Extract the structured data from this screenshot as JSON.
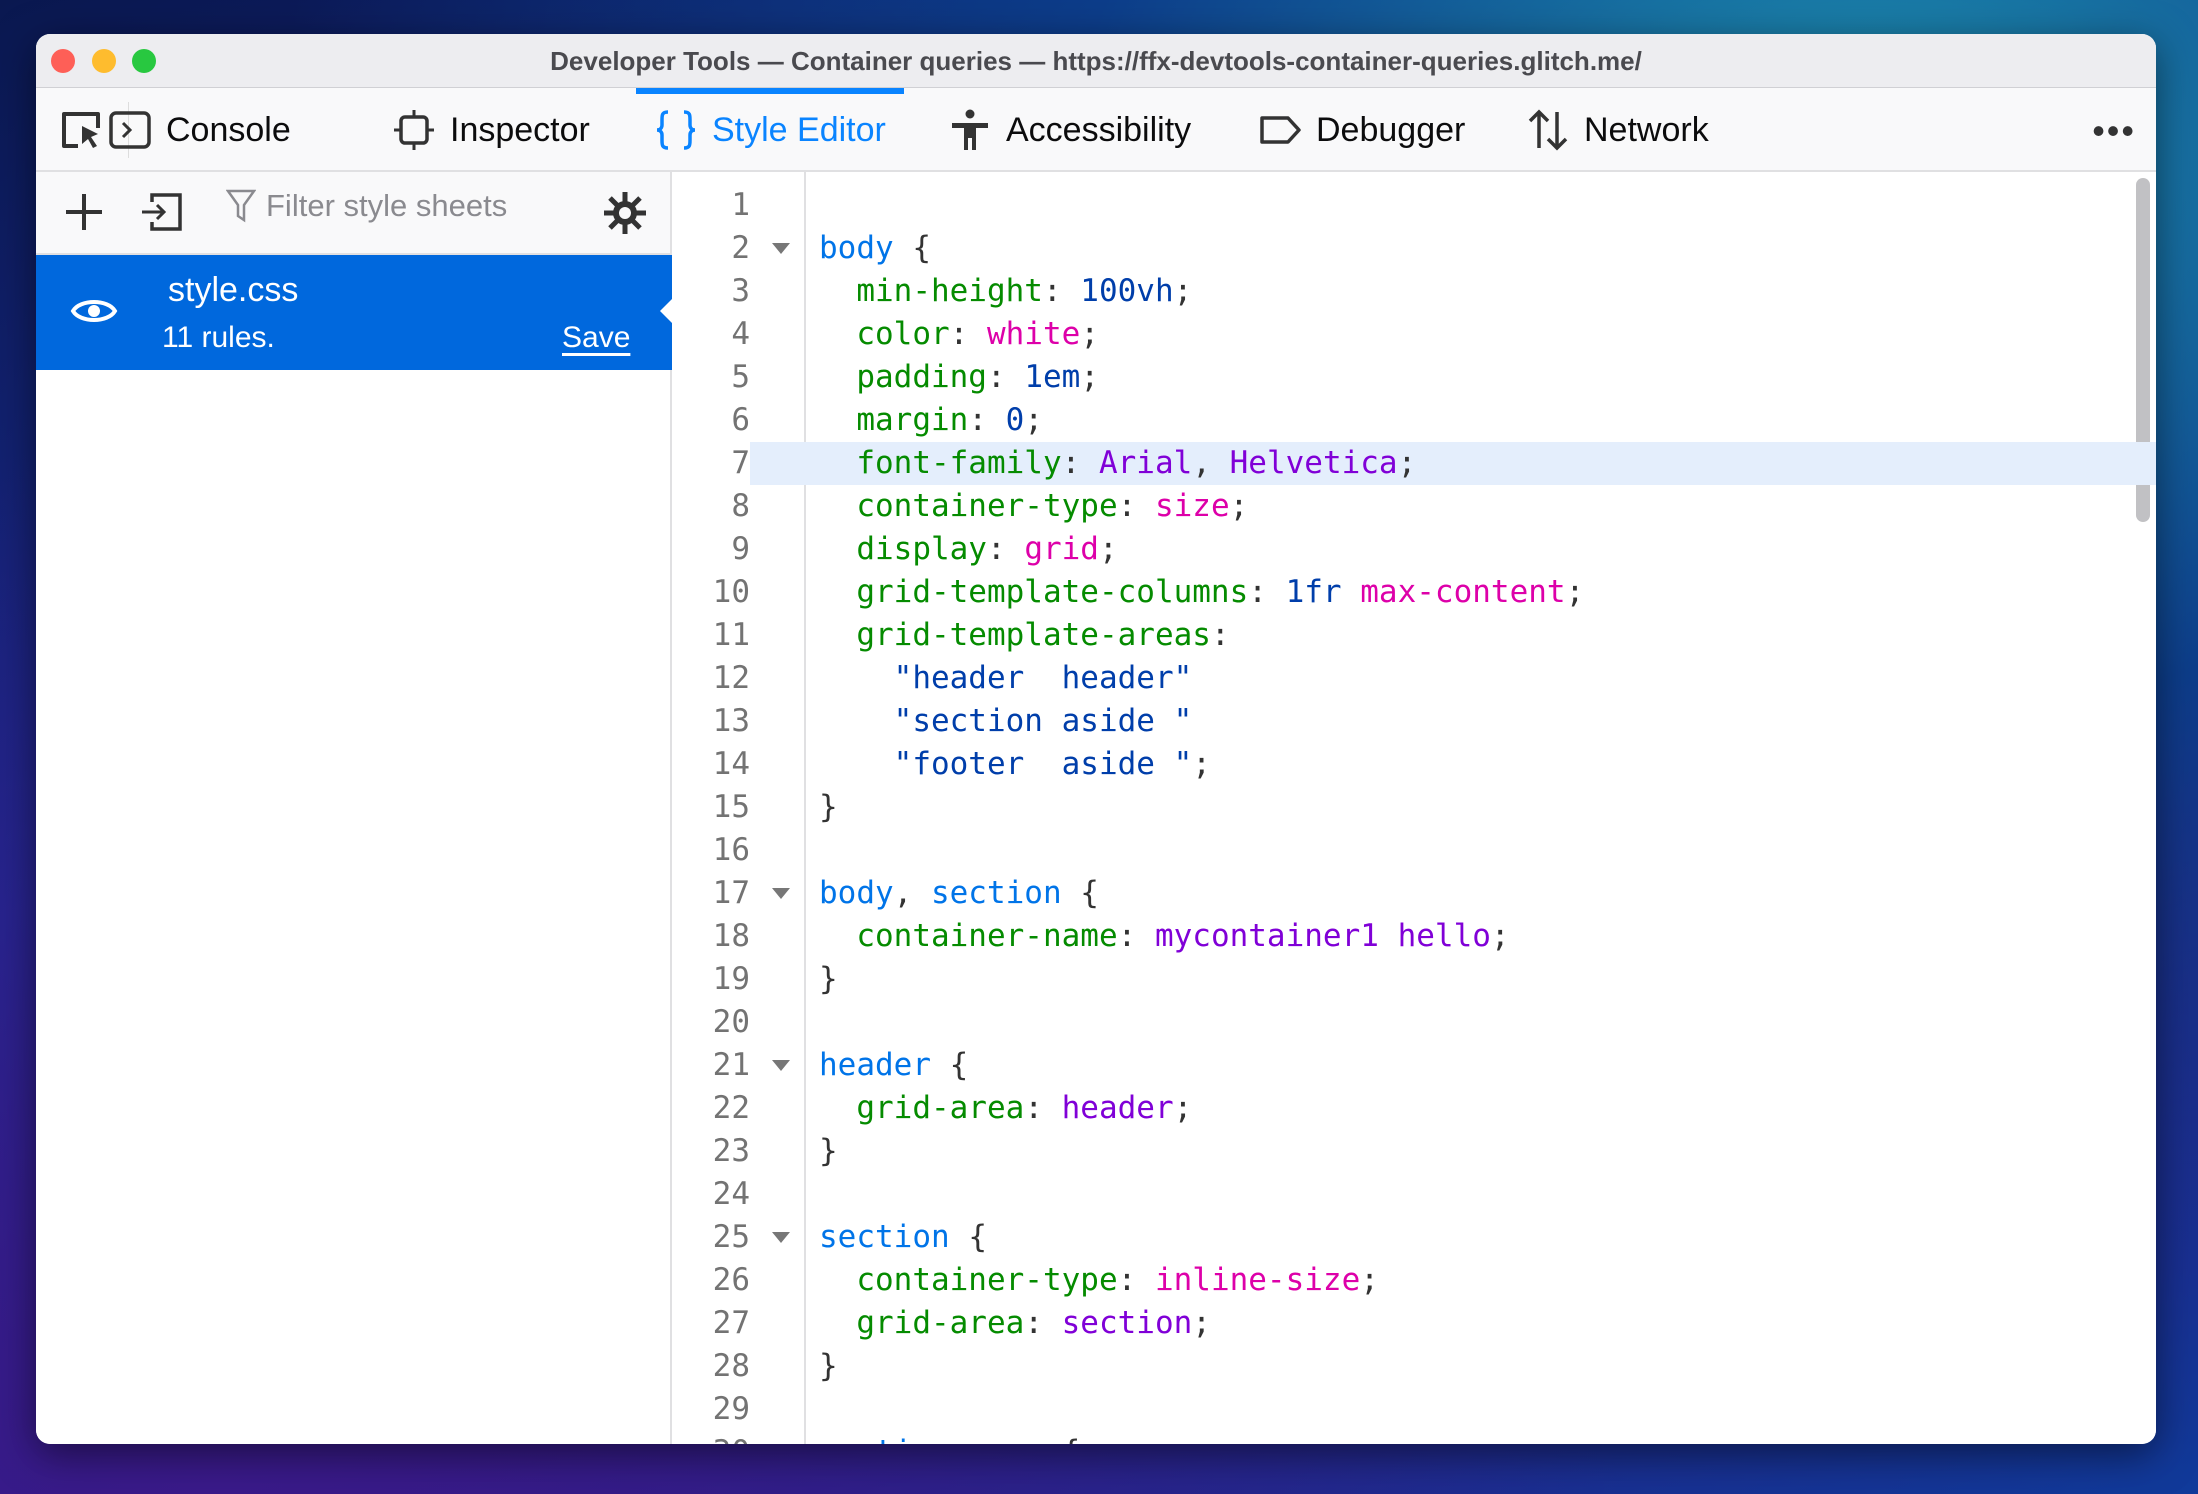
{
  "window": {
    "title": "Developer Tools — Container queries — https://ffx-devtools-container-queries.glitch.me/"
  },
  "toolbar": {
    "tabs": [
      {
        "label": "Console",
        "icon": "console-icon"
      },
      {
        "label": "Inspector",
        "icon": "inspector-icon"
      },
      {
        "label": "Style Editor",
        "icon": "braces-icon",
        "active": true
      },
      {
        "label": "Accessibility",
        "icon": "accessibility-icon"
      },
      {
        "label": "Debugger",
        "icon": "debugger-icon"
      },
      {
        "label": "Network",
        "icon": "network-icon"
      }
    ],
    "more": "•••"
  },
  "sidebar": {
    "filter_placeholder": "Filter style sheets",
    "sheets": [
      {
        "name": "style.css",
        "rules": "11 rules.",
        "save": "Save"
      }
    ]
  },
  "colors": {
    "accent": "#0a84ff",
    "selected": "#0068dd",
    "selector": "#0074e8",
    "property": "#058b00",
    "number": "#003eaa",
    "keyword": "#dd00a9",
    "identifier": "#8000d7"
  },
  "editor": {
    "highlighted_line": 7,
    "fold_lines": [
      2,
      17,
      21,
      25
    ],
    "lines": [
      [],
      [
        [
          "sel",
          "body"
        ],
        [
          "p",
          " {"
        ]
      ],
      [
        [
          "p",
          "  "
        ],
        [
          "prop",
          "min-height"
        ],
        [
          "p",
          ": "
        ],
        [
          "num",
          "100vh"
        ],
        [
          "p",
          ";"
        ]
      ],
      [
        [
          "p",
          "  "
        ],
        [
          "prop",
          "color"
        ],
        [
          "p",
          ": "
        ],
        [
          "kw",
          "white"
        ],
        [
          "p",
          ";"
        ]
      ],
      [
        [
          "p",
          "  "
        ],
        [
          "prop",
          "padding"
        ],
        [
          "p",
          ": "
        ],
        [
          "num",
          "1em"
        ],
        [
          "p",
          ";"
        ]
      ],
      [
        [
          "p",
          "  "
        ],
        [
          "prop",
          "margin"
        ],
        [
          "p",
          ": "
        ],
        [
          "num",
          "0"
        ],
        [
          "p",
          ";"
        ]
      ],
      [
        [
          "p",
          "  "
        ],
        [
          "prop",
          "font-family"
        ],
        [
          "p",
          ": "
        ],
        [
          "id",
          "Arial"
        ],
        [
          "p",
          ", "
        ],
        [
          "id",
          "Helvetica"
        ],
        [
          "p",
          ";"
        ]
      ],
      [
        [
          "p",
          "  "
        ],
        [
          "prop",
          "container-type"
        ],
        [
          "p",
          ": "
        ],
        [
          "kw",
          "size"
        ],
        [
          "p",
          ";"
        ]
      ],
      [
        [
          "p",
          "  "
        ],
        [
          "prop",
          "display"
        ],
        [
          "p",
          ": "
        ],
        [
          "kw",
          "grid"
        ],
        [
          "p",
          ";"
        ]
      ],
      [
        [
          "p",
          "  "
        ],
        [
          "prop",
          "grid-template-columns"
        ],
        [
          "p",
          ": "
        ],
        [
          "num",
          "1fr"
        ],
        [
          "p",
          " "
        ],
        [
          "kw",
          "max-content"
        ],
        [
          "p",
          ";"
        ]
      ],
      [
        [
          "p",
          "  "
        ],
        [
          "prop",
          "grid-template-areas"
        ],
        [
          "p",
          ":"
        ]
      ],
      [
        [
          "p",
          "    "
        ],
        [
          "str",
          "\"header  header\""
        ]
      ],
      [
        [
          "p",
          "    "
        ],
        [
          "str",
          "\"section aside \""
        ]
      ],
      [
        [
          "p",
          "    "
        ],
        [
          "str",
          "\"footer  aside \""
        ],
        [
          "p",
          ";"
        ]
      ],
      [
        [
          "p",
          "}"
        ]
      ],
      [],
      [
        [
          "sel",
          "body"
        ],
        [
          "p",
          ", "
        ],
        [
          "sel",
          "section"
        ],
        [
          "p",
          " {"
        ]
      ],
      [
        [
          "p",
          "  "
        ],
        [
          "prop",
          "container-name"
        ],
        [
          "p",
          ": "
        ],
        [
          "id",
          "mycontainer1 hello"
        ],
        [
          "p",
          ";"
        ]
      ],
      [
        [
          "p",
          "}"
        ]
      ],
      [],
      [
        [
          "sel",
          "header"
        ],
        [
          "p",
          " {"
        ]
      ],
      [
        [
          "p",
          "  "
        ],
        [
          "prop",
          "grid-area"
        ],
        [
          "p",
          ": "
        ],
        [
          "id",
          "header"
        ],
        [
          "p",
          ";"
        ]
      ],
      [
        [
          "p",
          "}"
        ]
      ],
      [],
      [
        [
          "sel",
          "section"
        ],
        [
          "p",
          " {"
        ]
      ],
      [
        [
          "p",
          "  "
        ],
        [
          "prop",
          "container-type"
        ],
        [
          "p",
          ": "
        ],
        [
          "kw",
          "inline-size"
        ],
        [
          "p",
          ";"
        ]
      ],
      [
        [
          "p",
          "  "
        ],
        [
          "prop",
          "grid-area"
        ],
        [
          "p",
          ": "
        ],
        [
          "id",
          "section"
        ],
        [
          "p",
          ";"
        ]
      ],
      [
        [
          "p",
          "}"
        ]
      ],
      [],
      [
        [
          "sel",
          "section span"
        ],
        [
          "p",
          " {"
        ]
      ]
    ]
  }
}
